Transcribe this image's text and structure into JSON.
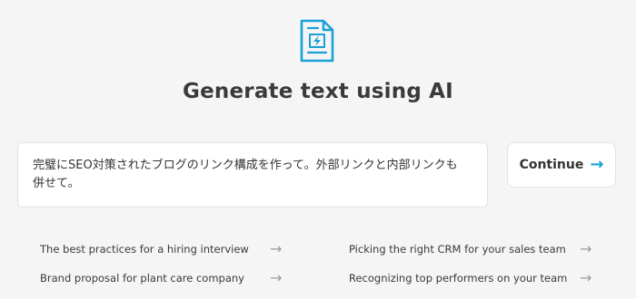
{
  "header": {
    "icon": "document-lightning-icon",
    "title": "Generate text using AI"
  },
  "prompt": {
    "value": "完璧にSEO対策されたブログのリンク構成を作って。外部リンクと内部リンクも併せて。"
  },
  "continue_button": {
    "label": "Continue",
    "icon": "arrow-right-icon"
  },
  "suggestions": [
    {
      "label": "The best practices for a hiring interview",
      "icon": "arrow-right-icon"
    },
    {
      "label": "Brand proposal for plant care company",
      "icon": "arrow-right-icon"
    },
    {
      "label": "Picking the right CRM for your sales team",
      "icon": "arrow-right-icon"
    },
    {
      "label": "Recognizing top performers on your team",
      "icon": "arrow-right-icon"
    }
  ],
  "colors": {
    "accent": "#1aa0d8",
    "background": "#f5f5f5"
  }
}
